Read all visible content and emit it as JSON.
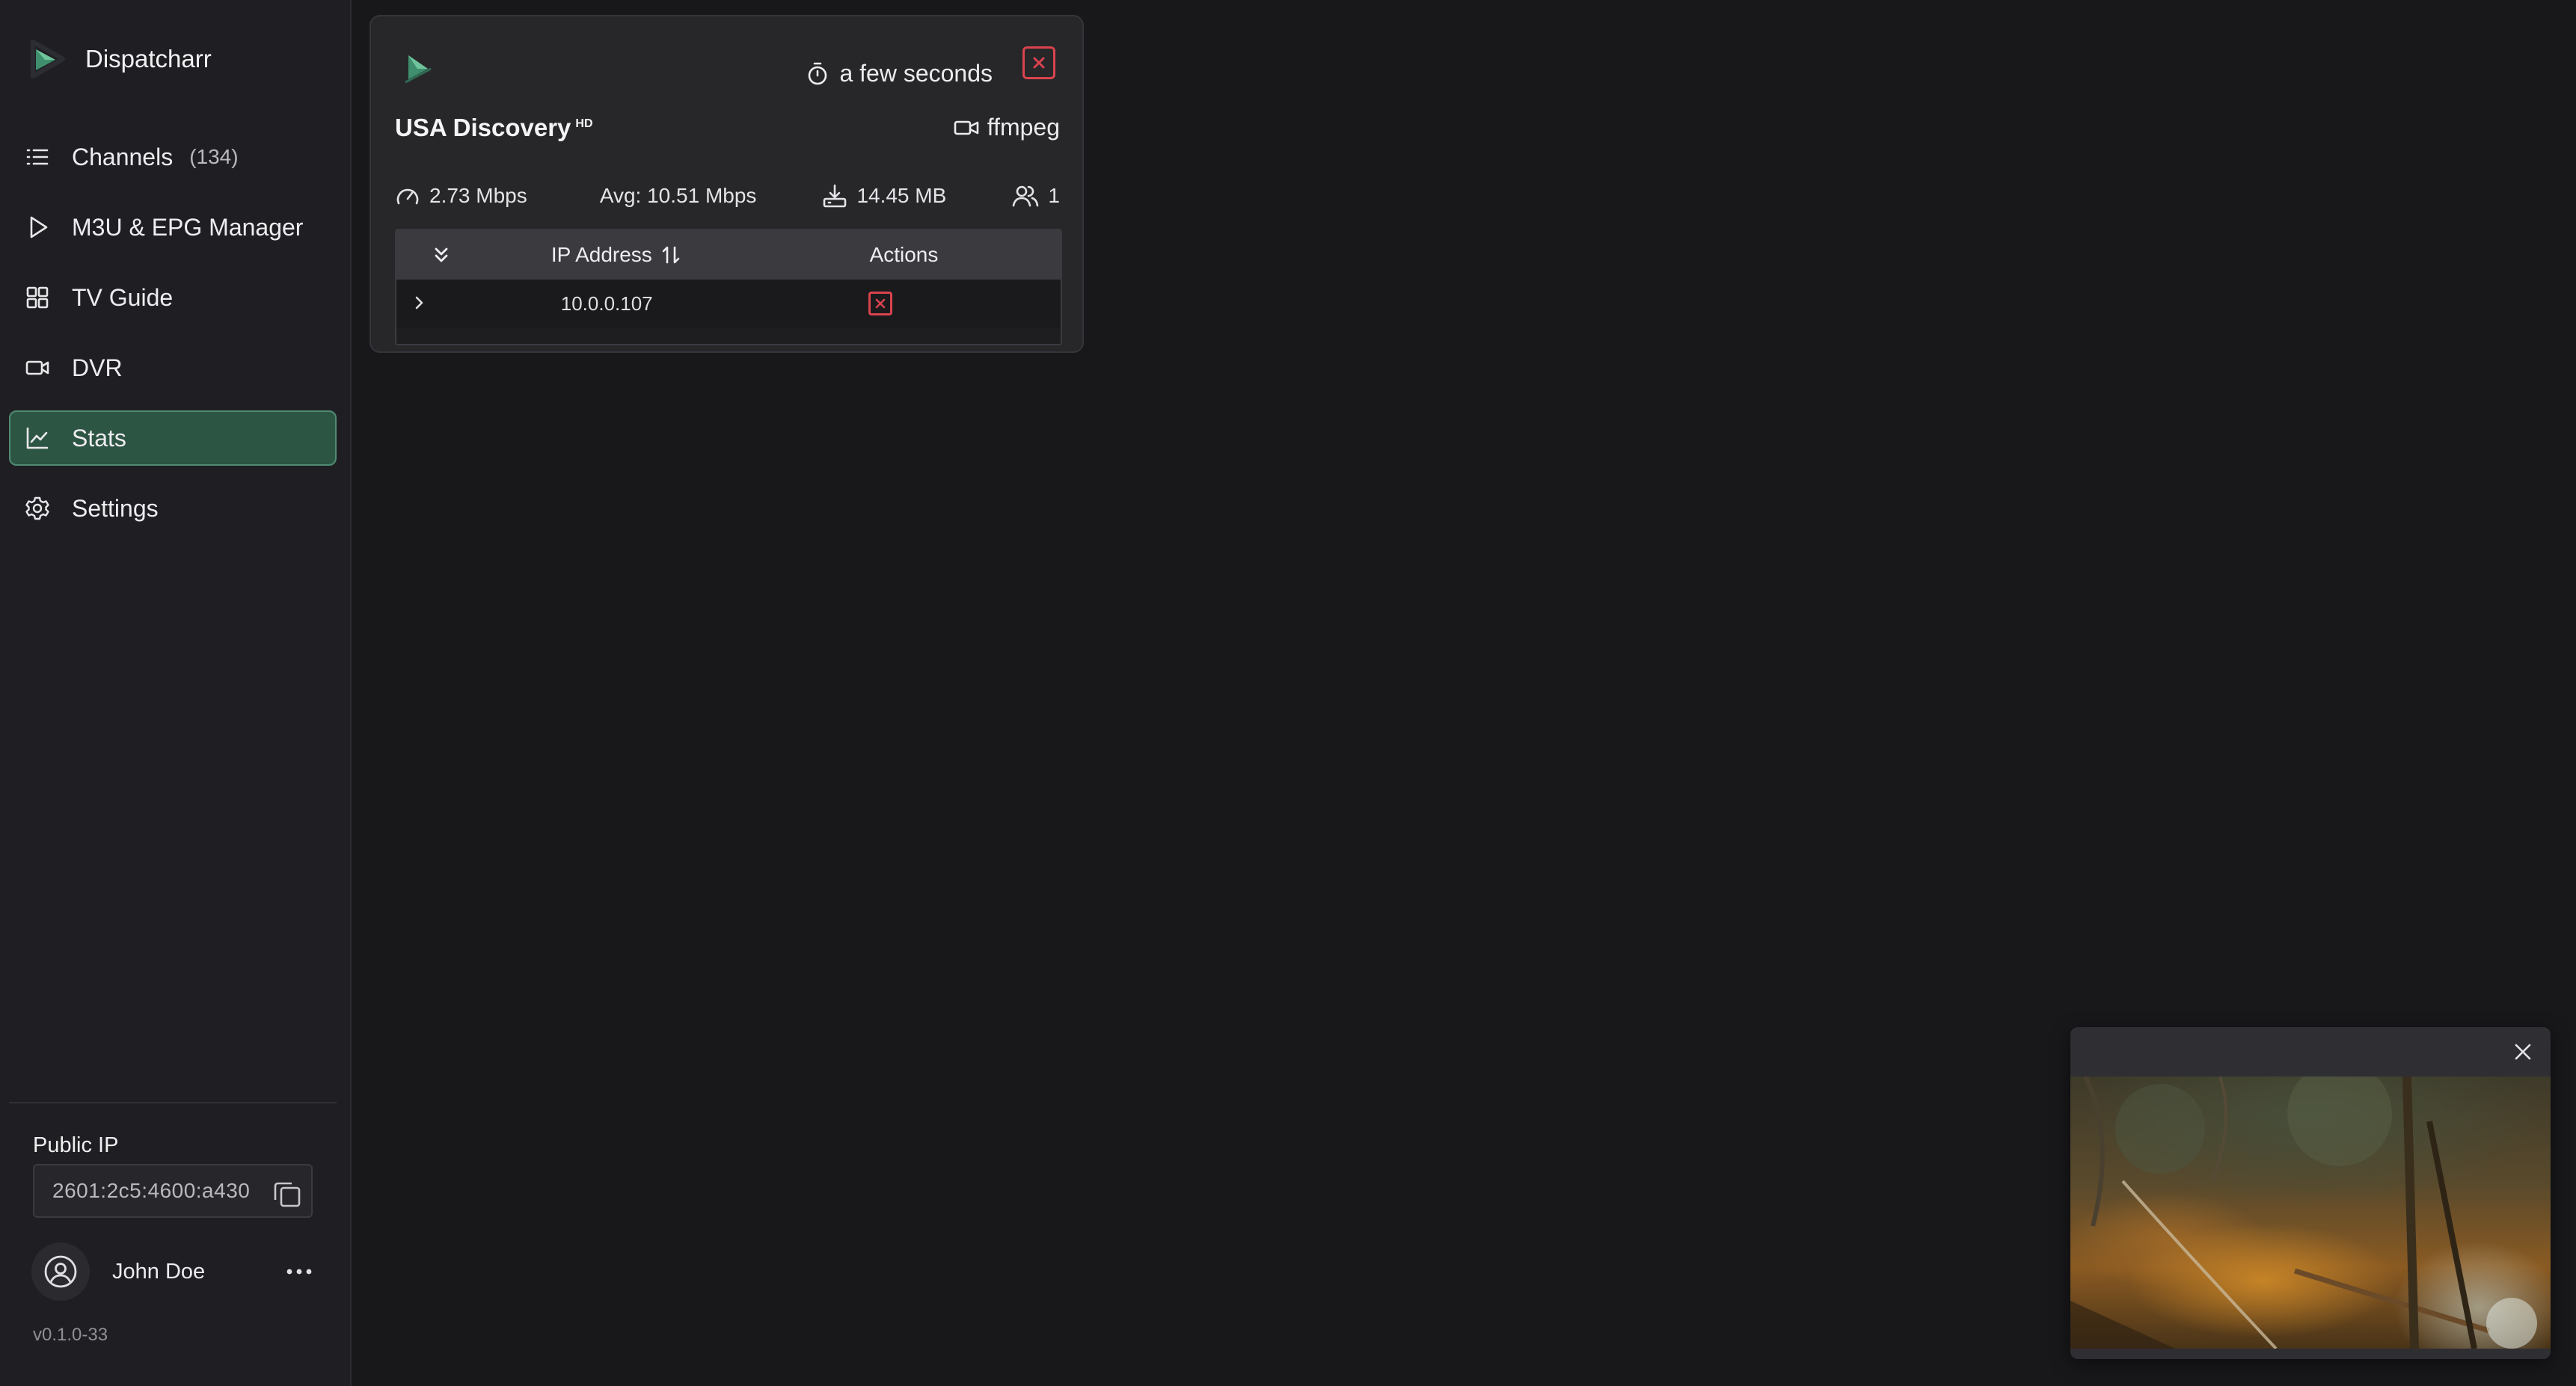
{
  "app": {
    "name": "Dispatcharr",
    "accent_color": "#4f8c72",
    "danger_color": "#d9434e"
  },
  "sidebar": {
    "items": [
      {
        "label": "Channels",
        "count": "(134)",
        "icon": "list-icon",
        "active": false
      },
      {
        "label": "M3U & EPG Manager",
        "count": "",
        "icon": "play-icon",
        "active": false
      },
      {
        "label": "TV Guide",
        "count": "",
        "icon": "grid-icon",
        "active": false
      },
      {
        "label": "DVR",
        "count": "",
        "icon": "video-camera-icon",
        "active": false
      },
      {
        "label": "Stats",
        "count": "",
        "icon": "chart-line-icon",
        "active": true
      },
      {
        "label": "Settings",
        "count": "",
        "icon": "gear-icon",
        "active": false
      }
    ],
    "public_ip_label": "Public IP",
    "public_ip_value": "2601:2c5:4600:a430",
    "user_name": "John Doe",
    "version": "v0.1.0-33"
  },
  "stream_card": {
    "uptime": "a few seconds",
    "channel_name": "USA Discovery",
    "hd_badge": "HD",
    "stream_profile": "ffmpeg",
    "current_bitrate": "2.73 Mbps",
    "avg_bitrate": "Avg: 10.51 Mbps",
    "total_data": "14.45 MB",
    "client_count": "1",
    "table": {
      "headers": {
        "ip": "IP Address",
        "actions": "Actions"
      },
      "rows": [
        {
          "ip": "10.0.0.107"
        }
      ]
    }
  },
  "player": {
    "state": "playing"
  }
}
